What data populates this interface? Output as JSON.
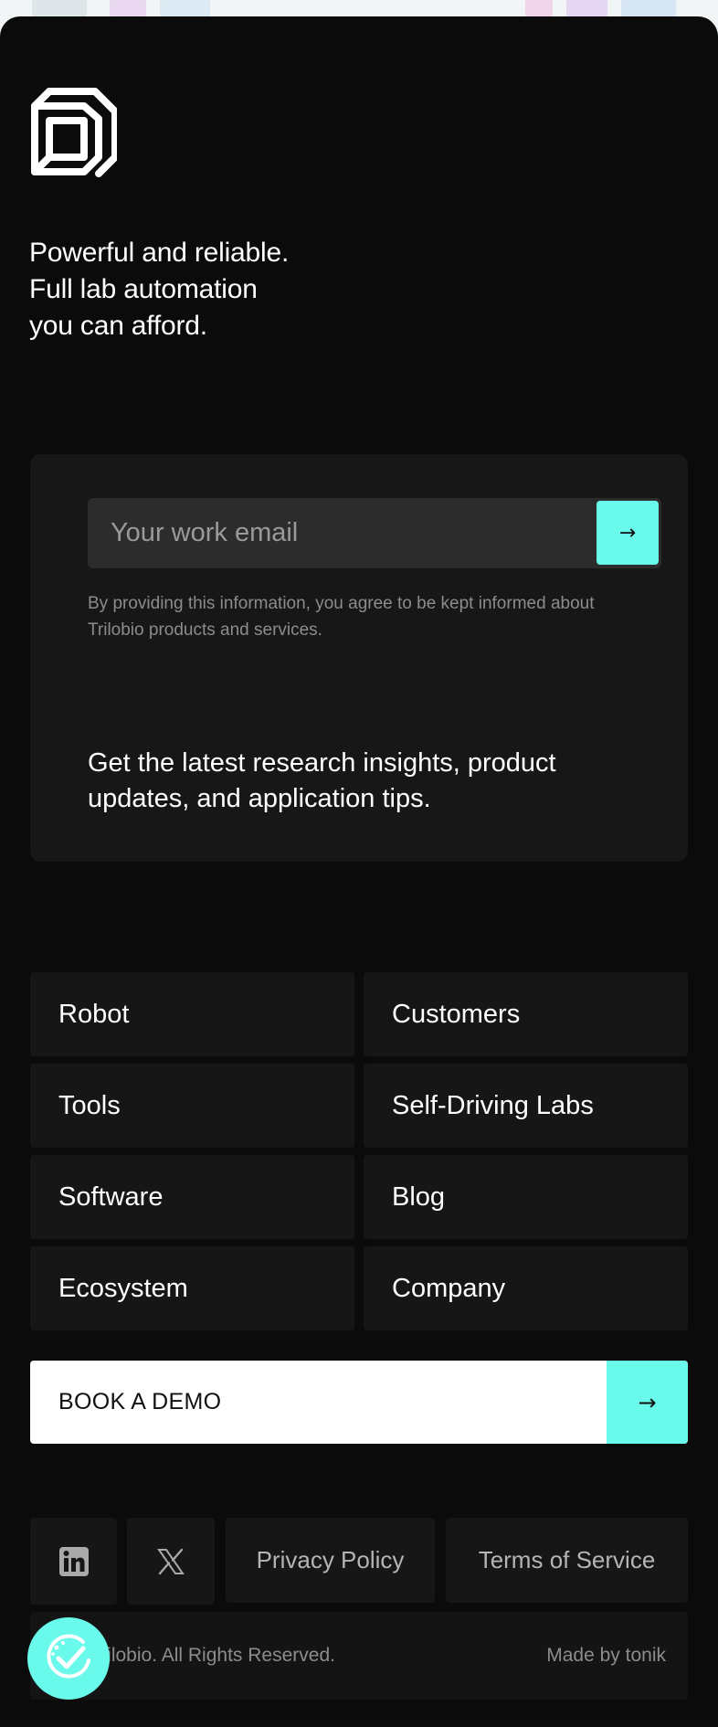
{
  "brand": {
    "accent_color": "#6afaeb",
    "logo_icon": "trilobio-logo-icon",
    "tagline_lines": [
      "Powerful and reliable.",
      "Full lab automation",
      "you can afford."
    ]
  },
  "newsletter": {
    "email_placeholder": "Your work email",
    "submit_label": "→",
    "consent_text": "By providing this information, you agree to be kept informed about Trilobio products and services.",
    "pitch": "Get the latest research insights, product updates, and application tips."
  },
  "nav": {
    "items": [
      {
        "label": "Robot"
      },
      {
        "label": "Customers"
      },
      {
        "label": "Tools"
      },
      {
        "label": "Self-Driving Labs"
      },
      {
        "label": "Software"
      },
      {
        "label": "Blog"
      },
      {
        "label": "Ecosystem"
      },
      {
        "label": "Company"
      }
    ]
  },
  "cta": {
    "label": "BOOK A DEMO",
    "arrow": "→"
  },
  "social": {
    "linkedin_icon": "linkedin-icon",
    "x_icon": "x-icon"
  },
  "legal": {
    "privacy": "Privacy Policy",
    "terms": "Terms of Service",
    "copyright": "6 Trilobio. All Rights Reserved.",
    "made_by": "Made by tonik"
  },
  "cookie_badge_icon": "cookie-check-icon"
}
